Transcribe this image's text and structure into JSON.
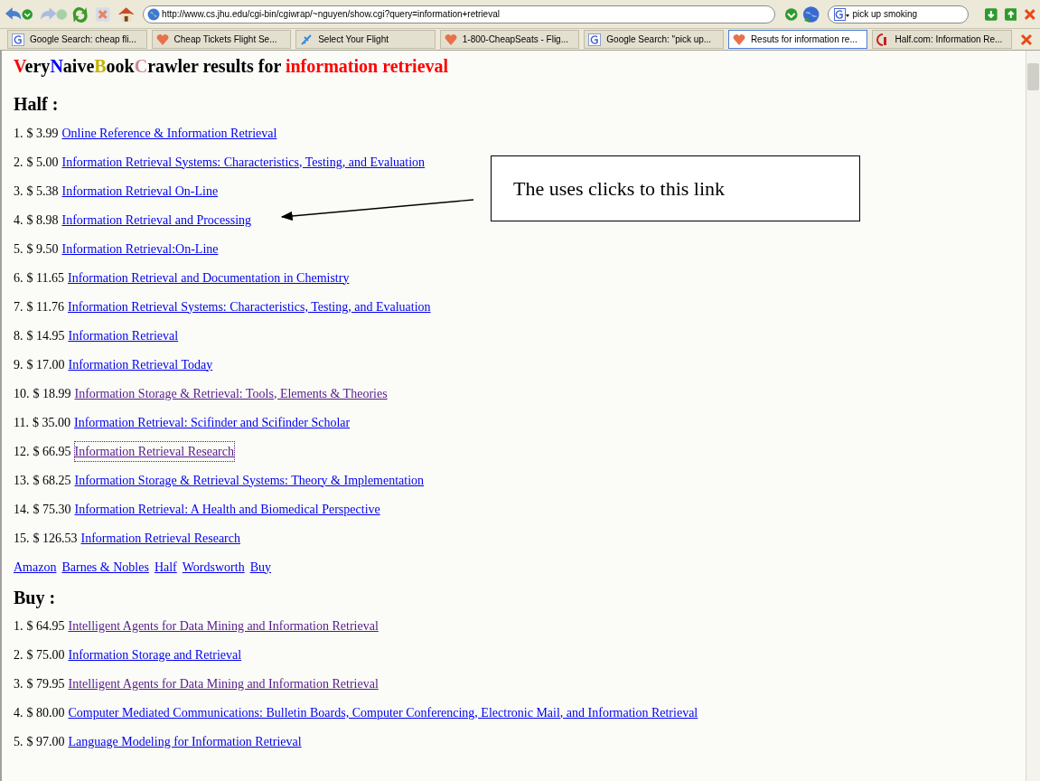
{
  "toolbar": {
    "url": "http://www.cs.jhu.edu/cgi-bin/cgiwrap/~nguyen/show.cgi?query=information+retrieval",
    "search": "pick up smoking"
  },
  "tabs": [
    {
      "label": "Google Search: cheap fli...",
      "kind": "google",
      "selected": false
    },
    {
      "label": "Cheap Tickets Flight Se...",
      "kind": "heart",
      "selected": false
    },
    {
      "label": "Select Your Flight",
      "kind": "plane",
      "selected": false
    },
    {
      "label": "1-800-CheapSeats - Flig...",
      "kind": "heart",
      "selected": false
    },
    {
      "label": "Google Search: \"pick up...",
      "kind": "google",
      "selected": false
    },
    {
      "label": "Resuts for information re...",
      "kind": "heart",
      "selected": true
    },
    {
      "label": "Half.com: Information Re...",
      "kind": "half",
      "selected": false
    }
  ],
  "title": [
    {
      "text": "V",
      "color": "#ff0000"
    },
    {
      "text": "ery",
      "color": "#000000"
    },
    {
      "text": "N",
      "color": "#0000ff"
    },
    {
      "text": "aive",
      "color": "#000000"
    },
    {
      "text": "B",
      "color": "#c8b000"
    },
    {
      "text": "ook",
      "color": "#000000"
    },
    {
      "text": "C",
      "color": "#d08898"
    },
    {
      "text": "rawler results for ",
      "color": "#000000"
    },
    {
      "text": "information retrieval",
      "color": "#ff0000"
    }
  ],
  "sections": [
    {
      "heading": "Half :",
      "items": [
        {
          "number": "1.",
          "price": "$ 3.99",
          "title": "Online Reference & Information Retrieval",
          "visited": false,
          "focused": false
        },
        {
          "number": "2.",
          "price": "$ 5.00",
          "title": "Information Retrieval Systems: Characteristics, Testing, and Evaluation",
          "visited": false,
          "focused": false
        },
        {
          "number": "3.",
          "price": "$ 5.38",
          "title": "Information Retrieval On-Line",
          "visited": false,
          "focused": false
        },
        {
          "number": "4.",
          "price": "$ 8.98",
          "title": "Information Retrieval and Processing",
          "visited": false,
          "focused": false
        },
        {
          "number": "5.",
          "price": "$ 9.50",
          "title": "Information Retrieval:On-Line",
          "visited": false,
          "focused": false
        },
        {
          "number": "6.",
          "price": "$ 11.65",
          "title": "Information Retrieval and Documentation in Chemistry",
          "visited": false,
          "focused": false
        },
        {
          "number": "7.",
          "price": "$ 11.76",
          "title": "Information Retrieval Systems: Characteristics, Testing, and Evaluation",
          "visited": false,
          "focused": false
        },
        {
          "number": "8.",
          "price": "$ 14.95",
          "title": "Information Retrieval",
          "visited": false,
          "focused": false
        },
        {
          "number": "9.",
          "price": "$ 17.00",
          "title": "Information Retrieval Today",
          "visited": false,
          "focused": false
        },
        {
          "number": "10.",
          "price": "$ 18.99",
          "title": "Information Storage & Retrieval: Tools, Elements & Theories",
          "visited": true,
          "focused": false
        },
        {
          "number": "11.",
          "price": "$ 35.00",
          "title": "Information Retrieval: Scifinder and Scifinder Scholar",
          "visited": false,
          "focused": false
        },
        {
          "number": "12.",
          "price": "$ 66.95",
          "title": "Information Retrieval Research",
          "visited": true,
          "focused": true
        },
        {
          "number": "13.",
          "price": "$ 68.25",
          "title": "Information Storage & Retrieval Systems: Theory & Implementation",
          "visited": false,
          "focused": false
        },
        {
          "number": "14.",
          "price": "$ 75.30",
          "title": "Information Retrieval: A Health and Biomedical Perspective",
          "visited": false,
          "focused": false
        },
        {
          "number": "15.",
          "price": "$ 126.53",
          "title": "Information Retrieval Research",
          "visited": false,
          "focused": false
        }
      ],
      "nav_links": [
        "Amazon",
        "Barnes & Nobles",
        "Half",
        "Wordsworth",
        "Buy"
      ]
    },
    {
      "heading": "Buy :",
      "items": [
        {
          "number": "1.",
          "price": "$ 64.95",
          "title": "Intelligent Agents for Data Mining and Information Retrieval",
          "visited": true,
          "focused": false
        },
        {
          "number": "2.",
          "price": "$ 75.00",
          "title": "Information Storage and Retrieval",
          "visited": false,
          "focused": false
        },
        {
          "number": "3.",
          "price": "$ 79.95",
          "title": "Intelligent Agents for Data Mining and Information Retrieval",
          "visited": true,
          "focused": false
        },
        {
          "number": "4.",
          "price": "$ 80.00",
          "title": "Computer Mediated Communications: Bulletin Boards, Computer Conferencing, Electronic Mail, and Information Retrieval",
          "visited": false,
          "focused": false
        },
        {
          "number": "5.",
          "price": "$ 97.00",
          "title": "Language Modeling for Information Retrieval",
          "visited": false,
          "focused": false
        }
      ]
    }
  ],
  "callout": "The uses clicks to this link"
}
